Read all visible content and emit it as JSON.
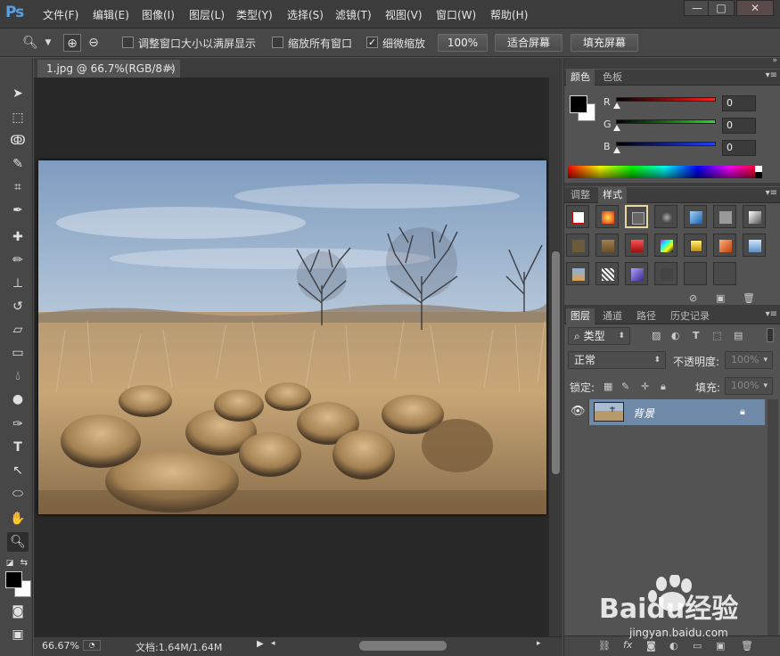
{
  "app": {
    "logo": "Ps"
  },
  "menu": [
    "文件(F)",
    "编辑(E)",
    "图像(I)",
    "图层(L)",
    "类型(Y)",
    "选择(S)",
    "滤镜(T)",
    "视图(V)",
    "窗口(W)",
    "帮助(H)"
  ],
  "window_buttons": {
    "minimize": "—",
    "restore": "□",
    "close": "✕"
  },
  "options": {
    "resize_windows": "调整窗口大小以满屏显示",
    "zoom_all_windows": "缩放所有窗口",
    "scrubby_zoom": "细微缩放",
    "btn_100": "100%",
    "btn_fit": "适合屏幕",
    "btn_fill": "填充屏幕"
  },
  "document": {
    "tab_title": "1.jpg @ 66.7%(RGB/8#)",
    "tab_close": "×",
    "zoom": "66.67%",
    "doc_info": "文档:1.64M/1.64M"
  },
  "color_panel": {
    "tabs": [
      "颜色",
      "色板"
    ],
    "channels": [
      {
        "label": "R",
        "value": "0",
        "color": "#ff2020"
      },
      {
        "label": "G",
        "value": "0",
        "color": "#20e020"
      },
      {
        "label": "B",
        "value": "0",
        "color": "#2040ff"
      }
    ]
  },
  "styles_panel": {
    "tabs": [
      "调整",
      "样式"
    ]
  },
  "layers_panel": {
    "tabs": [
      "图层",
      "通道",
      "路径",
      "历史记录"
    ],
    "filter_kind": "类型",
    "blend_mode": "正常",
    "opacity_label": "不透明度:",
    "opacity_value": "100%",
    "lock_label": "锁定:",
    "fill_label": "填充:",
    "fill_value": "100%",
    "layers": [
      {
        "name": "背景"
      }
    ]
  },
  "watermark": {
    "brand": "Baidu经验",
    "url": "jingyan.baidu.com"
  }
}
